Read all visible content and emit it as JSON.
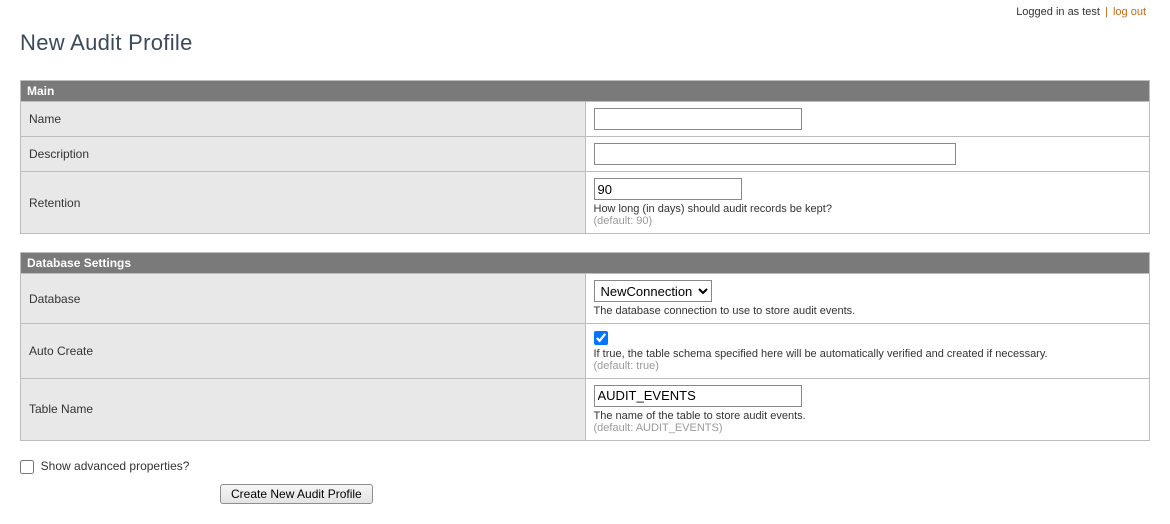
{
  "topbar": {
    "logged_in_text": "Logged in as test",
    "separator": "|",
    "logout_text": "log out"
  },
  "page_title": "New Audit Profile",
  "sections": {
    "main": {
      "heading": "Main",
      "fields": {
        "name": {
          "label": "Name",
          "value": ""
        },
        "description": {
          "label": "Description",
          "value": ""
        },
        "retention": {
          "label": "Retention",
          "value": "90",
          "help": "How long (in days) should audit records be kept?",
          "default_text": "(default: 90)"
        }
      }
    },
    "db": {
      "heading": "Database Settings",
      "fields": {
        "database": {
          "label": "Database",
          "selected": "NewConnection",
          "options": [
            "NewConnection"
          ],
          "help": "The database connection to use to store audit events."
        },
        "auto_create": {
          "label": "Auto Create",
          "checked": true,
          "help": "If true, the table schema specified here will be automatically verified and created if necessary.",
          "default_text": "(default: true)"
        },
        "table_name": {
          "label": "Table Name",
          "value": "AUDIT_EVENTS",
          "help": "The name of the table to store audit events.",
          "default_text": "(default: AUDIT_EVENTS)"
        }
      }
    }
  },
  "footer": {
    "show_advanced_label": "Show advanced properties?",
    "show_advanced_checked": false,
    "submit_label": "Create New Audit Profile"
  }
}
